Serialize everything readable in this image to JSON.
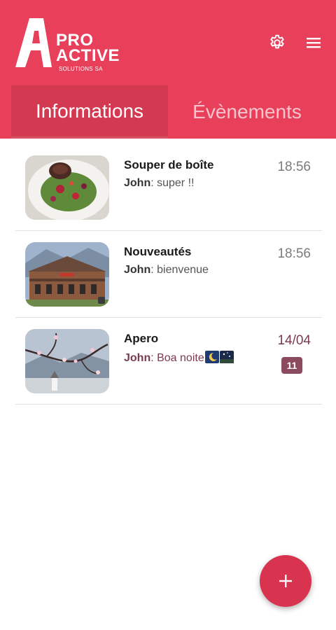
{
  "logo": {
    "line1": "PRO",
    "line2": "ACTIVE",
    "subtitle": "SOLUTIONS SA"
  },
  "header": {
    "settings_icon": "gear-icon",
    "menu_icon": "hamburger-menu-icon"
  },
  "tabs": [
    {
      "label": "Informations",
      "selected": true
    },
    {
      "label": "Évènements",
      "selected": false
    }
  ],
  "conversations": [
    {
      "title": "Souper de boîte",
      "sender": "John",
      "message": ": super !!",
      "time": "18:56",
      "thumbnail": "salad-plate-photo"
    },
    {
      "title": "Nouveautés",
      "sender": "John",
      "message": ": bienvenue",
      "time": "18:56",
      "thumbnail": "chalet-building-photo"
    },
    {
      "title": "Apero",
      "sender": "John",
      "message": ": Boa noite",
      "time": "14/04",
      "badge": "11",
      "thumbnail": "blossom-tree-photo"
    }
  ],
  "fab": {
    "icon": "plus-icon"
  },
  "colors": {
    "primary": "#e8405b",
    "tab_active": "#d33a52",
    "badge": "#8b4a5e",
    "fab": "#d9344f"
  }
}
